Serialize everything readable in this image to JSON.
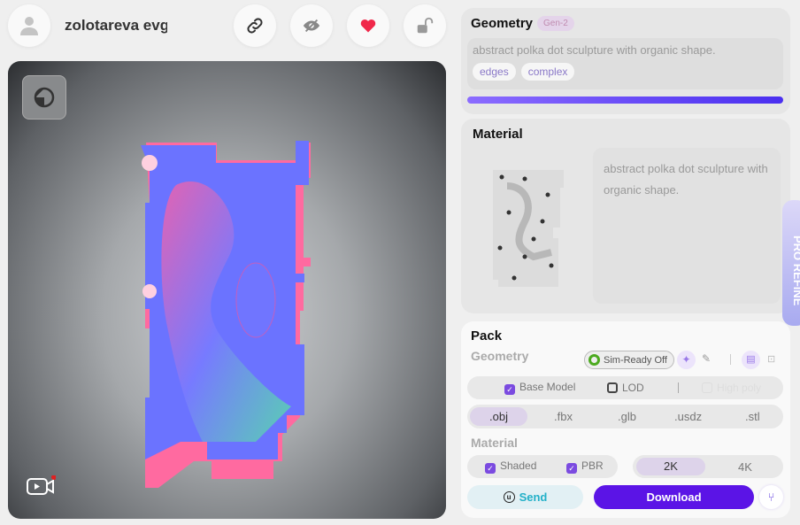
{
  "header": {
    "username": "zolotareva evge"
  },
  "geometry": {
    "title": "Geometry",
    "badge": "Gen-2",
    "prompt": "abstract polka dot sculpture with organic shape.",
    "tags": [
      "edges",
      "complex"
    ],
    "progress": 100
  },
  "material": {
    "title": "Material",
    "prompt": "abstract polka dot sculpture with organic shape."
  },
  "side_tab": {
    "label": "PRO REFINE"
  },
  "pack": {
    "title": "Pack",
    "geometry_label": "Geometry",
    "sim_ready": "Sim-Ready Off",
    "options": {
      "base_model": "Base Model",
      "lod": "LOD",
      "high_poly": "High poly"
    },
    "formats": [
      ".obj",
      ".fbx",
      ".glb",
      ".usdz",
      ".stl"
    ],
    "selected_format": ".obj",
    "material_label": "Material",
    "shaded": "Shaded",
    "pbr": "PBR",
    "resolutions": [
      "2K",
      "4K"
    ],
    "send": "Send",
    "download": "Download"
  },
  "colors": {
    "accent": "#5b14e6",
    "heart": "#f0284a"
  }
}
